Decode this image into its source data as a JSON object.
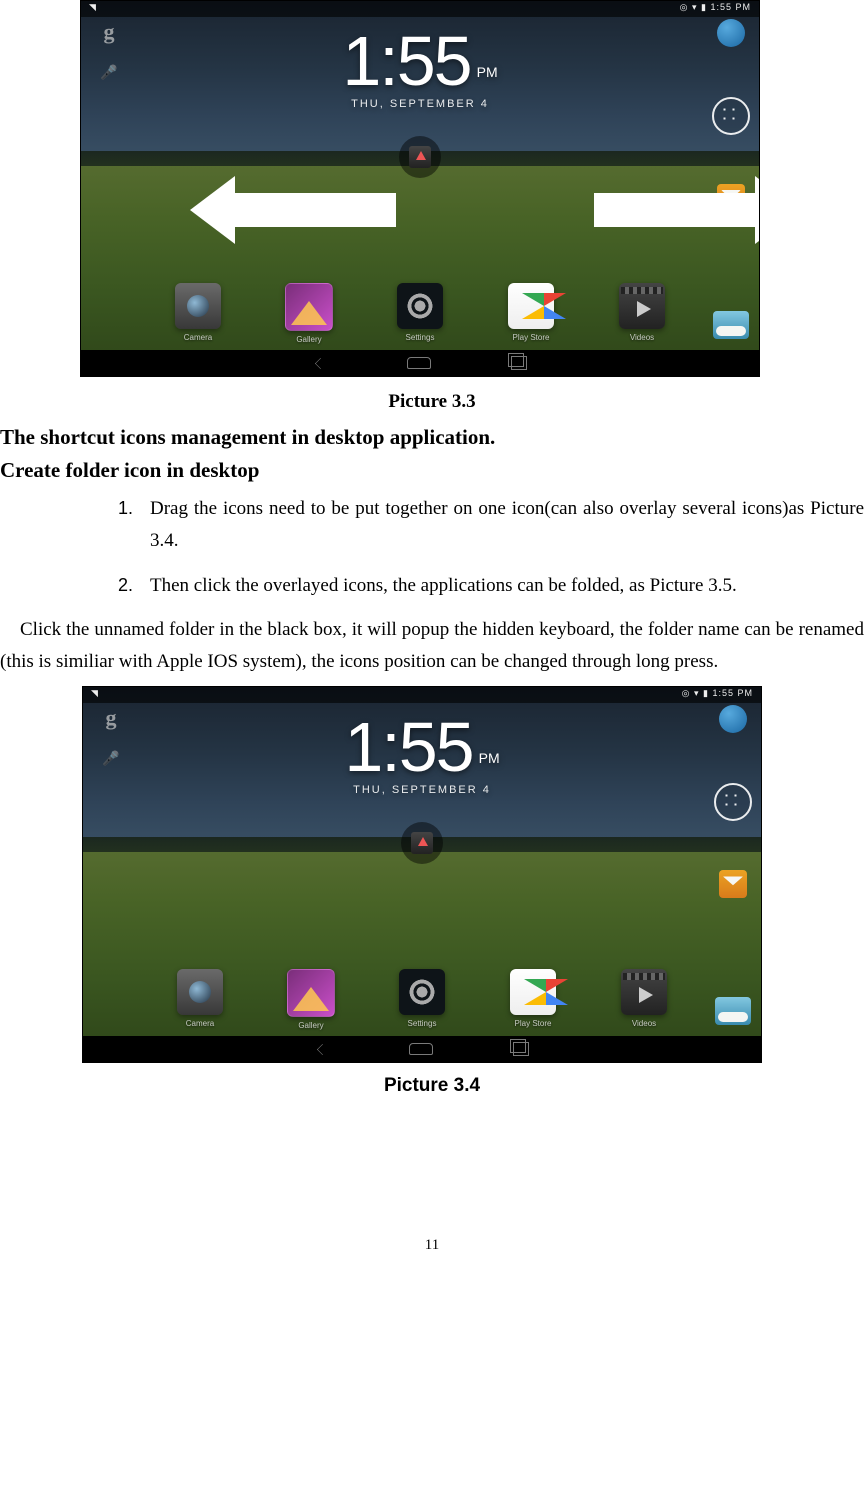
{
  "page_number": "11",
  "caption_top": "Picture 3.3",
  "heading": "The shortcut icons management in desktop application.",
  "subheading": "Create folder icon in desktop",
  "list": [
    {
      "num": "1.",
      "text": "Drag the icons need to be put together on one icon(can also overlay several icons)as Picture 3.4."
    },
    {
      "num": "2.",
      "text": "Then click the overlayed icons, the applications can be folded, as Picture 3.5."
    }
  ],
  "paragraph": "Click the unnamed folder in the black box, it will popup the hidden keyboard, the folder name can be renamed (this is similiar with Apple IOS system), the icons position can be changed through long press.",
  "caption_bottom": "Picture 3.4",
  "screenshot": {
    "status_time": "1:55 PM",
    "status_icons": "◎ ▾ ▮",
    "clock_time": "1:55",
    "clock_ampm": "PM",
    "clock_date": "THU, SEPTEMBER 4",
    "dock": [
      {
        "label": "Camera"
      },
      {
        "label": "Gallery"
      },
      {
        "label": "Settings"
      },
      {
        "label": "Play Store"
      },
      {
        "label": "Videos"
      }
    ]
  }
}
